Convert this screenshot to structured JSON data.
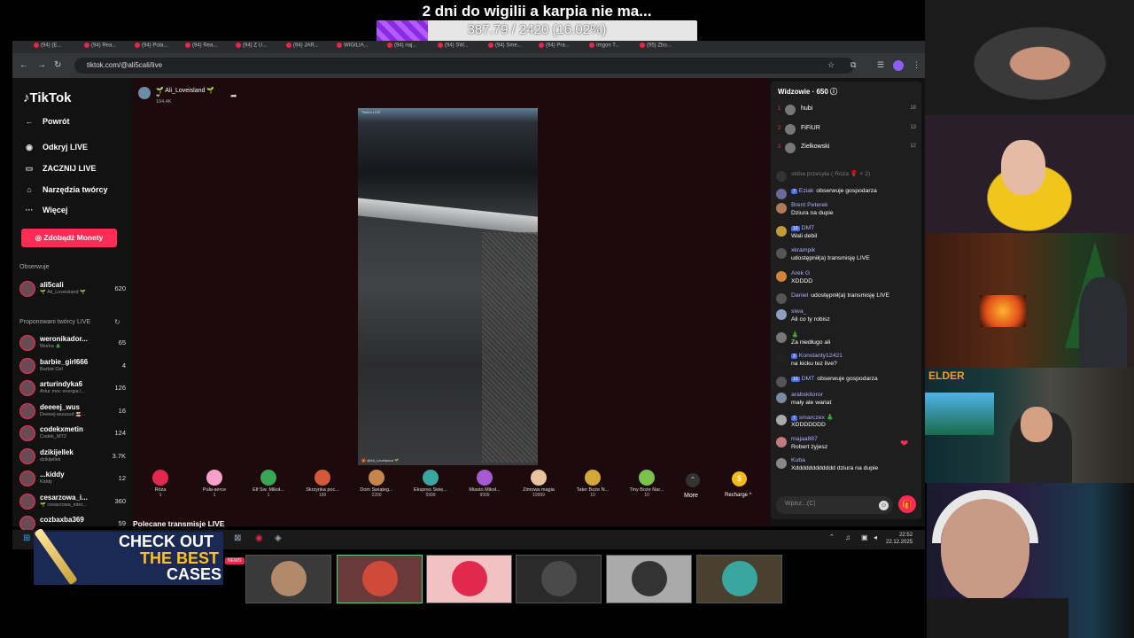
{
  "overlay": {
    "goal_title": "2 dni do wigilii a karpia nie ma...",
    "goal_progress_text": "387.79 / 2420 (16.02%)",
    "goal_fraction": 0.1602,
    "goal_color": "#8a2be2"
  },
  "browser": {
    "tabs": [
      "(94) (E...",
      "(94) Rea...",
      "(94) Pola...",
      "(94) Rea...",
      "(94) Z U...",
      "(94) JAR...",
      "WIGILIA...",
      "(94) naj...",
      "(94) SW...",
      "(94) Sme...",
      "(94) Pra...",
      "Imgon T...",
      "(95) Zbo..."
    ],
    "url": "tiktok.com/@ali5cali/live"
  },
  "tiktok": {
    "logo": "TikTok",
    "nav": [
      {
        "icon": "back-icon",
        "label": "Powrót"
      },
      {
        "icon": "live-icon",
        "label": "Odkryj LIVE"
      },
      {
        "icon": "camera-icon",
        "label": "ZACZNIJ LIVE"
      },
      {
        "icon": "tools-icon",
        "label": "Narzędzia twórcy"
      },
      {
        "icon": "more-icon",
        "label": "Więcej"
      }
    ],
    "coins_button": "Zdobądź Monety",
    "following_header": "Obserwuje",
    "following": [
      {
        "name": "ali5cali",
        "sub": "🌱 Ali_Loveisland 🌱",
        "count": "620"
      }
    ],
    "suggested_header": "Proponowani twórcy LIVE",
    "suggested": [
      {
        "name": "weronikador...",
        "sub": "Worka 🎄",
        "count": "65"
      },
      {
        "name": "barbie_girl666",
        "sub": "Barbie Girl",
        "count": "4"
      },
      {
        "name": "arturindyka6",
        "sub": "Artur moc energia l...",
        "count": "126"
      },
      {
        "name": "deeeej_wus",
        "sub": "Deeeej-wuuuud 🏖️...",
        "count": "16"
      },
      {
        "name": "codekxmetin",
        "sub": "Codek_MT2",
        "count": "124"
      },
      {
        "name": "dzikijellek",
        "sub": "dzikijellek",
        "count": "3.7K"
      },
      {
        "name": "...kiddy",
        "sub": "Kiddy",
        "count": "12"
      },
      {
        "name": "cesarzowa_i...",
        "sub": "🌱 cesarzowa_inter...",
        "count": "360"
      },
      {
        "name": "cozbaxba369",
        "sub": "",
        "count": "59"
      }
    ],
    "host_name": "🌱 Ali_Loveisland 🌱",
    "host_likes": "❤ 104.4K",
    "video_label": "Twiera LIVE",
    "video_bottom": "🎁 @Ali_Loveisland 🌱",
    "gifts": [
      {
        "name": "Róża",
        "price": "1",
        "color": "#e2284c"
      },
      {
        "name": "Puła-serce",
        "price": "1",
        "color": "#f7a0c8"
      },
      {
        "name": "Elf Św. Mikoł...",
        "price": "1",
        "color": "#3aa655"
      },
      {
        "name": "Skrzynka poc...",
        "price": "199",
        "color": "#d25a3a"
      },
      {
        "name": "Dom Świąteg...",
        "price": "2200",
        "color": "#c4864a"
      },
      {
        "name": "Ekspres Świę...",
        "price": "5999",
        "color": "#3aa6a0"
      },
      {
        "name": "Miasto Mikoł...",
        "price": "9999",
        "color": "#a65ad2"
      },
      {
        "name": "Zimowa magia",
        "price": "19999",
        "color": "#e8c3a0"
      },
      {
        "name": "Tater Boże N...",
        "price": "10",
        "color": "#d2a83a"
      },
      {
        "name": "Tiny Boże Nar...",
        "price": "10",
        "color": "#7ac24a"
      }
    ],
    "more_label": "More",
    "recharge_label": "Recharge ^",
    "recommended_header": "Polecane transmisje LIVE"
  },
  "chat": {
    "viewers_header": "Widzowie · 650 ⓘ",
    "top_viewers": [
      {
        "rank": "1",
        "name": "hubi",
        "count": "18"
      },
      {
        "rank": "2",
        "name": "FiFiUR",
        "count": "13"
      },
      {
        "rank": "3",
        "name": "Zielkowski",
        "count": "12"
      }
    ],
    "gift_notice": "skiba przesyła ( Róża 🌹 × 2)",
    "messages": [
      {
        "type": "info",
        "badge": "7",
        "user": "Eziak",
        "text": "obserwuje gospodarza"
      },
      {
        "type": "msg",
        "badge": "",
        "user": "Brent Peterek",
        "text": "Dziura na dupie"
      },
      {
        "type": "msg",
        "badge": "10",
        "user": "DMT",
        "text": "Wali debil"
      },
      {
        "type": "msg",
        "badge": "",
        "user": "xkrampik",
        "text": "udostępnił(a) transmisję LIVE"
      },
      {
        "type": "msg",
        "badge": "",
        "user": "Arek G",
        "text": "XDDDD"
      },
      {
        "type": "info",
        "badge": "",
        "user": "Daniel",
        "text": "udostępnił(a) transmisję LIVE"
      },
      {
        "type": "msg",
        "badge": "",
        "user": "siwa_",
        "text": "Ali co ty robisz"
      },
      {
        "type": "msg",
        "badge": "",
        "user": "🎄",
        "text": "Za niedługo ali"
      },
      {
        "type": "msg",
        "badge": "3",
        "user": "Konstanty12421",
        "text": "na kicku tez live?"
      },
      {
        "type": "info",
        "badge": "10",
        "user": "DMT",
        "text": "obserwuje gospodarza"
      },
      {
        "type": "msg",
        "badge": "",
        "user": "arabskitoror",
        "text": "mały ale wariat"
      },
      {
        "type": "msg",
        "badge": "7",
        "user": "smarczex 🎄",
        "text": "XDDDDDDD"
      },
      {
        "type": "msg",
        "badge": "",
        "user": "majaa887",
        "text": "Robert żyjesz"
      },
      {
        "type": "msg",
        "badge": "",
        "user": "Kuba",
        "text": "Xdddddddddddd dziura na dupie"
      }
    ],
    "input_placeholder": "Wpisz...(C)"
  },
  "taskbar": {
    "time": "22:52",
    "date": "22.12.2025"
  },
  "stream_overlay": {
    "promo_line1": "CHECK OUT",
    "promo_line2": "THE BEST",
    "promo_line3": "CASES",
    "promo_badge": "NEWO",
    "cam4_logo": "ELDER"
  }
}
